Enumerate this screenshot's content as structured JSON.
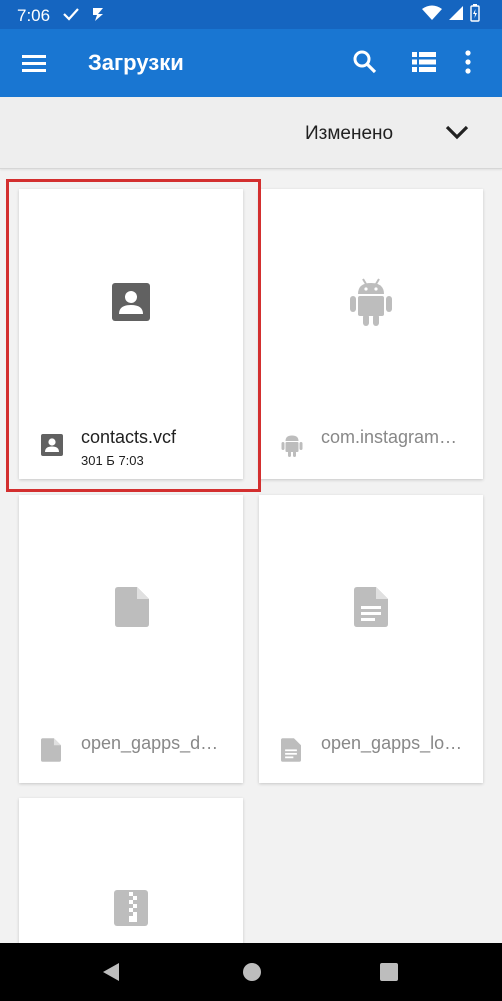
{
  "status_bar": {
    "time": "7:06"
  },
  "app_bar": {
    "title": "Загрузки"
  },
  "sort_bar": {
    "label": "Изменено"
  },
  "files": [
    {
      "name": "contacts.vcf",
      "meta": "301 Б 7:03",
      "icon": "contact-icon",
      "selected": true
    },
    {
      "name": "com.instagram…",
      "icon": "android-icon"
    },
    {
      "name": "open_gapps_d…",
      "icon": "file-icon"
    },
    {
      "name": "open_gapps_lo…",
      "icon": "document-icon"
    },
    {
      "name": "",
      "icon": "archive-icon"
    }
  ],
  "colors": {
    "status_bar": "#1565c0",
    "app_bar": "#1976d2",
    "highlight": "#d32f2f",
    "icon_active": "#616161",
    "icon_inactive": "#bdbdbd"
  }
}
